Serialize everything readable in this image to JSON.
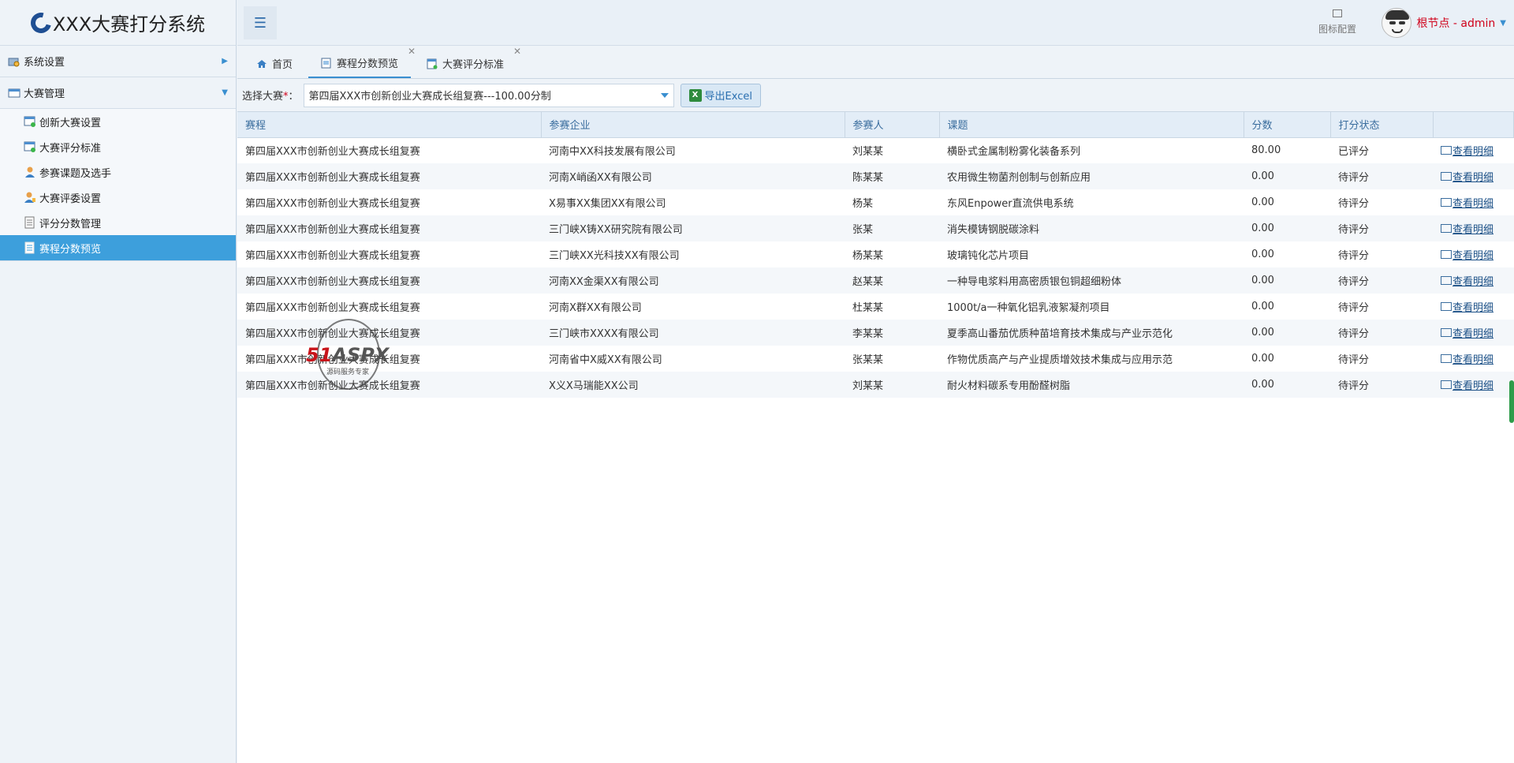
{
  "app": {
    "title": "XXX大赛打分系统"
  },
  "header": {
    "icon_config_label": "图标配置",
    "user_label": "根节点 - admin"
  },
  "sidebar": {
    "groups": [
      {
        "label": "系统设置",
        "expanded": false
      },
      {
        "label": "大赛管理",
        "expanded": true
      }
    ],
    "items": [
      {
        "label": "创新大赛设置"
      },
      {
        "label": "大赛评分标准"
      },
      {
        "label": "参赛课题及选手"
      },
      {
        "label": "大赛评委设置"
      },
      {
        "label": "评分分数管理"
      },
      {
        "label": "赛程分数预览",
        "active": true
      }
    ]
  },
  "tabs": [
    {
      "label": "首页",
      "icon": "home-icon"
    },
    {
      "label": "赛程分数预览",
      "icon": "page-icon",
      "active": true
    },
    {
      "label": "大赛评分标准",
      "icon": "page-icon"
    }
  ],
  "filter": {
    "label": "选择大赛",
    "required_mark": "*",
    "colon": "：",
    "selected": "第四届XXX市创新创业大赛成长组复赛---100.00分制",
    "export_label": "导出Excel"
  },
  "table": {
    "columns": [
      "赛程",
      "参赛企业",
      "参赛人",
      "课题",
      "分数",
      "打分状态",
      ""
    ],
    "detail_label": "查看明细",
    "rows": [
      [
        "第四届XXX市创新创业大赛成长组复赛",
        "河南中XX科技发展有限公司",
        "刘某某",
        "横卧式金属制粉雾化装备系列",
        "80.00",
        "已评分"
      ],
      [
        "第四届XXX市创新创业大赛成长组复赛",
        "河南X峭函XX有限公司",
        "陈某某",
        "农用微生物菌剂创制与创新应用",
        "0.00",
        "待评分"
      ],
      [
        "第四届XXX市创新创业大赛成长组复赛",
        "X易事XX集团XX有限公司",
        "杨某",
        "东风Enpower直流供电系统",
        "0.00",
        "待评分"
      ],
      [
        "第四届XXX市创新创业大赛成长组复赛",
        "三门峡X铸XX研究院有限公司",
        "张某",
        "消失模铸钢脱碳涂料",
        "0.00",
        "待评分"
      ],
      [
        "第四届XXX市创新创业大赛成长组复赛",
        "三门峡XX光科技XX有限公司",
        "杨某某",
        "玻璃钝化芯片项目",
        "0.00",
        "待评分"
      ],
      [
        "第四届XXX市创新创业大赛成长组复赛",
        "河南XX金渠XX有限公司",
        "赵某某",
        "一种导电浆料用高密质银包铜超细粉体",
        "0.00",
        "待评分"
      ],
      [
        "第四届XXX市创新创业大赛成长组复赛",
        "河南X群XX有限公司",
        "杜某某",
        "1000t/a一种氧化铝乳液絮凝剂项目",
        "0.00",
        "待评分"
      ],
      [
        "第四届XXX市创新创业大赛成长组复赛",
        "三门峡市XXXX有限公司",
        "李某某",
        "夏季高山番茄优质种苗培育技术集成与产业示范化",
        "0.00",
        "待评分"
      ],
      [
        "第四届XXX市创新创业大赛成长组复赛",
        "河南省中X威XX有限公司",
        "张某某",
        "作物优质高产与产业提质增效技术集成与应用示范",
        "0.00",
        "待评分"
      ],
      [
        "第四届XXX市创新创业大赛成长组复赛",
        "X义X马瑞能XX公司",
        "刘某某",
        "耐火材料碳系专用酚醛树脂",
        "0.00",
        "待评分"
      ]
    ]
  },
  "watermark": {
    "text_red": "51",
    "text_gray": "ASPX",
    "sub": "源码服务专家"
  }
}
